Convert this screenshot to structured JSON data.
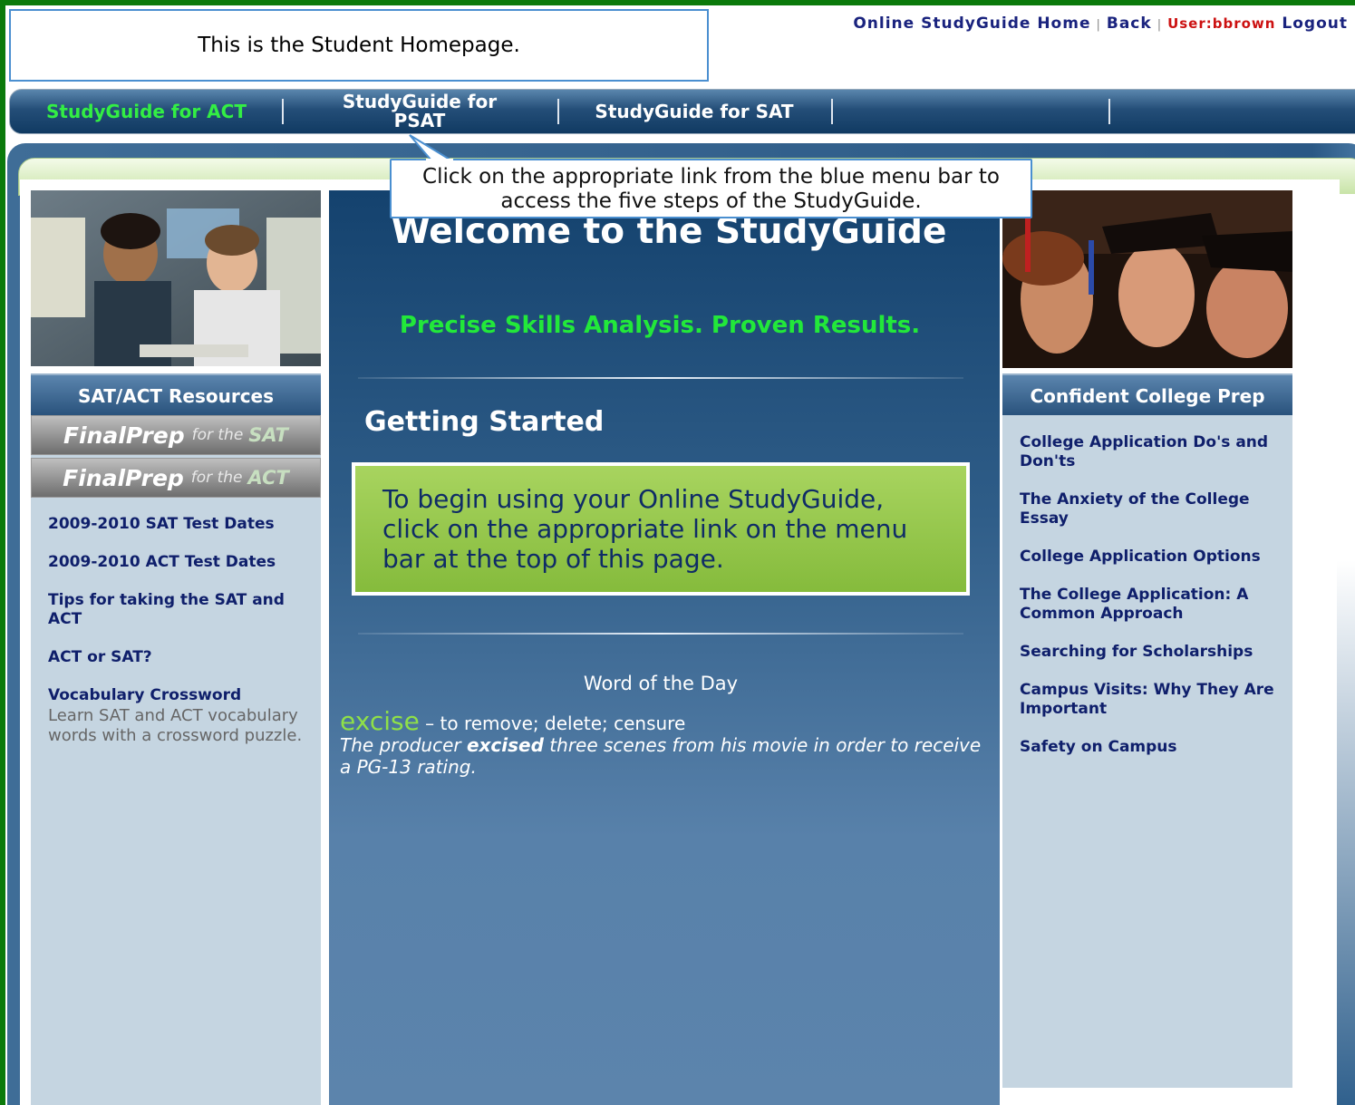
{
  "banner": {
    "text": "This is the Student Homepage."
  },
  "top_links": {
    "home": "Online StudyGuide Home",
    "sep": "|",
    "back": "Back",
    "user": "User:bbrown",
    "logout": "Logout"
  },
  "nav": {
    "items": [
      {
        "label": "StudyGuide for ACT"
      },
      {
        "label": "StudyGuide for PSAT"
      },
      {
        "label": "StudyGuide for SAT"
      }
    ]
  },
  "tooltip": {
    "text": "Click on the appropriate link from the blue menu bar to access the five steps of the StudyGuide."
  },
  "left": {
    "title": "SAT/ACT Resources",
    "finalprep_sat": {
      "brand": "FinalPrep",
      "for": "for the",
      "test": "SAT"
    },
    "finalprep_act": {
      "brand": "FinalPrep",
      "for": "for the",
      "test": "ACT"
    },
    "links": [
      "2009-2010 SAT Test Dates",
      "2009-2010 ACT Test Dates",
      "Tips for taking the SAT and ACT",
      "ACT or SAT?",
      "Vocabulary Crossword"
    ],
    "crossword_desc": "Learn SAT and ACT vocabulary words with a crossword puzzle."
  },
  "center": {
    "welcome": "Welcome to the StudyGuide",
    "tagline": "Precise Skills Analysis. Proven Results.",
    "getting_started": "Getting Started",
    "box_text": "To begin using your Online StudyGuide, click on the appropriate link on the menu bar at the top of this page.",
    "wotd_title": "Word of the Day",
    "word": "excise",
    "definition": " – to remove; delete; censure",
    "example_pre": "The producer ",
    "example_bold": "excised",
    "example_post": " three scenes from his movie in order to receive a PG-13 rating."
  },
  "right": {
    "title": "Confident College Prep",
    "links": [
      "College Application Do's and Don'ts",
      "The Anxiety of the College Essay",
      "College Application Options",
      "The College Application: A Common Approach",
      "Searching for Scholarships",
      "Campus Visits: Why They Are Important",
      "Safety on Campus"
    ]
  },
  "colors": {
    "outer_green": "#0b7a0b",
    "nav_active": "#33ee44",
    "tagline": "#22e83a",
    "link": "#0f1f6b"
  }
}
